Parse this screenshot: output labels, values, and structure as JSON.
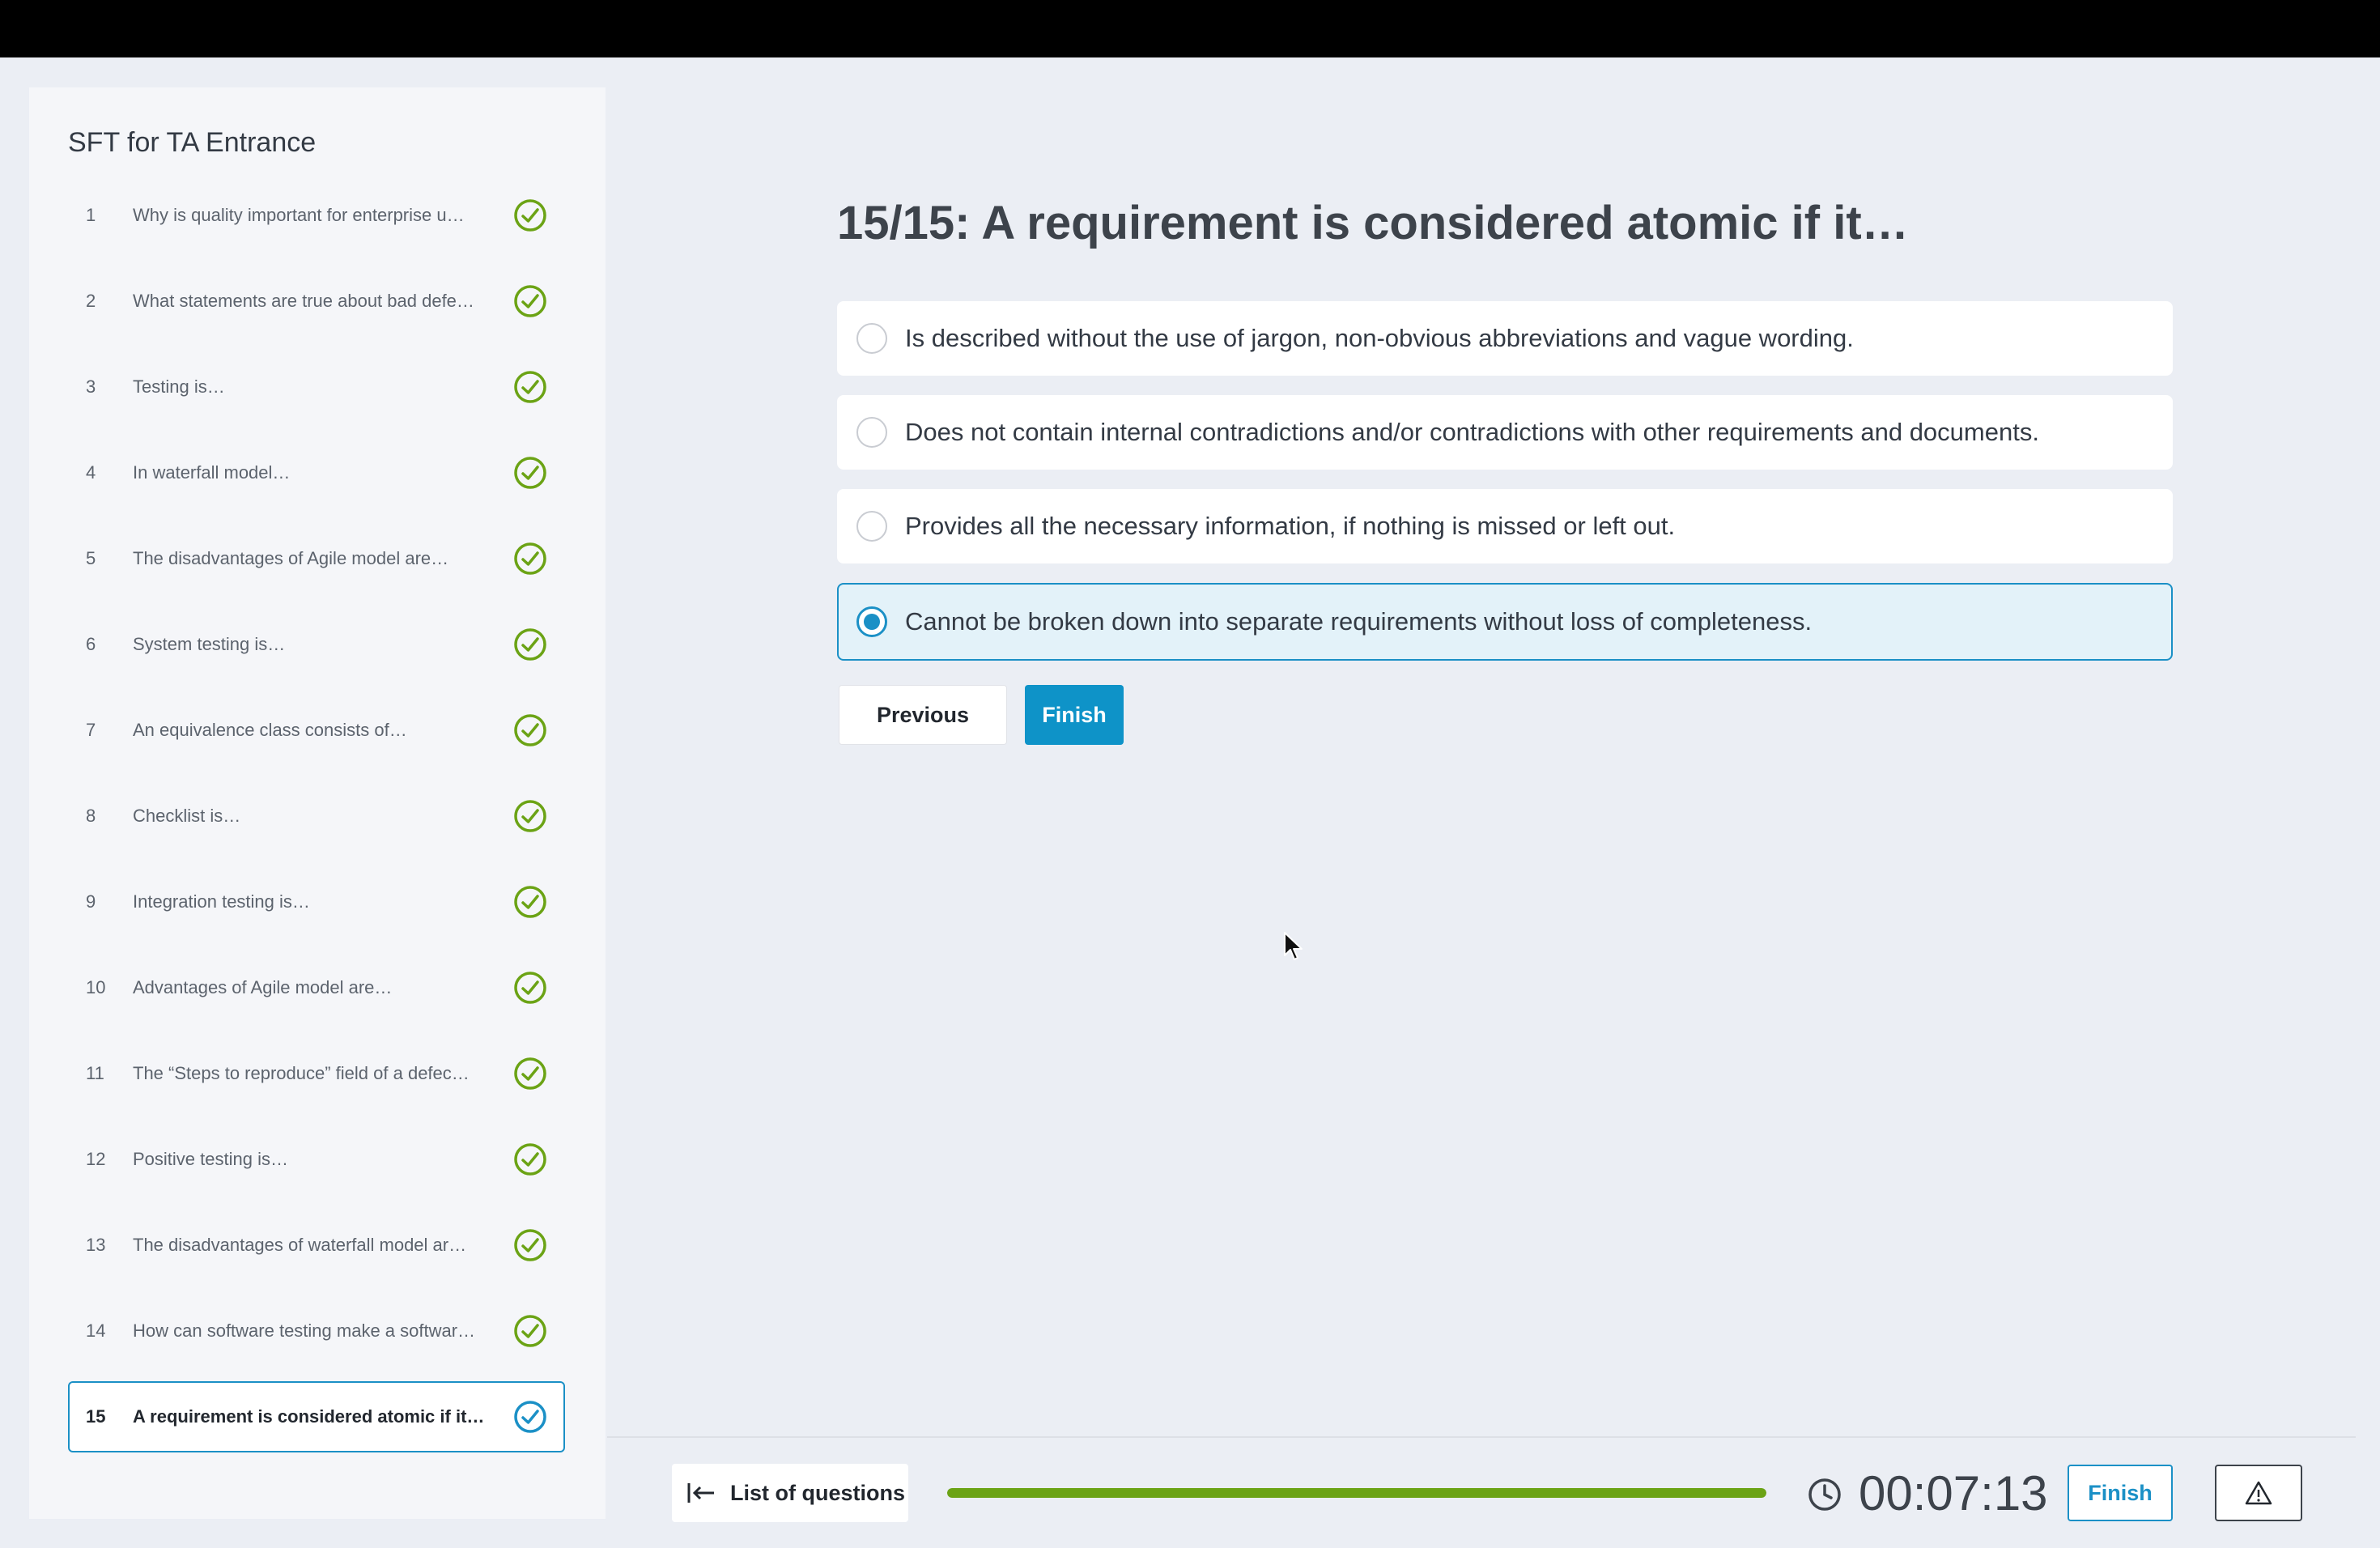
{
  "sidebar": {
    "title": "SFT for TA Entrance",
    "questions": [
      {
        "num": "1",
        "label": "Why is quality important for enterprise u…",
        "status": "answered"
      },
      {
        "num": "2",
        "label": "What statements are true about bad defe…",
        "status": "answered"
      },
      {
        "num": "3",
        "label": "Testing is…",
        "status": "answered"
      },
      {
        "num": "4",
        "label": "In waterfall model…",
        "status": "answered"
      },
      {
        "num": "5",
        "label": "The disadvantages of Agile model are…",
        "status": "answered"
      },
      {
        "num": "6",
        "label": "System testing is…",
        "status": "answered"
      },
      {
        "num": "7",
        "label": "An equivalence class consists of…",
        "status": "answered"
      },
      {
        "num": "8",
        "label": "Checklist is…",
        "status": "answered"
      },
      {
        "num": "9",
        "label": "Integration testing is…",
        "status": "answered"
      },
      {
        "num": "10",
        "label": "Advantages of Agile model are…",
        "status": "answered"
      },
      {
        "num": "11",
        "label": "The “Steps to reproduce” field of a defec…",
        "status": "answered"
      },
      {
        "num": "12",
        "label": "Positive testing is…",
        "status": "answered"
      },
      {
        "num": "13",
        "label": "The disadvantages of waterfall model ar…",
        "status": "answered"
      },
      {
        "num": "14",
        "label": "How can software testing make a softwar…",
        "status": "answered"
      },
      {
        "num": "15",
        "label": "A requirement is considered atomic if it…",
        "status": "answered",
        "active": true
      }
    ]
  },
  "main": {
    "title": "15/15: A requirement is considered atomic if it…",
    "options": [
      {
        "text": "Is described without the use of jargon, non-obvious abbreviations and vague wording.",
        "selected": false
      },
      {
        "text": "Does not contain internal contradictions and/or contradictions with other requirements and documents.",
        "selected": false
      },
      {
        "text": "Provides all the necessary information, if nothing is missed or left out.",
        "selected": false
      },
      {
        "text": "Cannot be broken down into separate requirements without loss of completeness.",
        "selected": true
      }
    ],
    "previous_label": "Previous",
    "finish_label": "Finish"
  },
  "footer": {
    "list_label": "List of questions",
    "progress": 1.0,
    "timer": "00:07:13",
    "finish_label": "Finish"
  },
  "colors": {
    "accent": "#1b90c6",
    "primary_button": "#0e93c8",
    "success": "#6ba315"
  },
  "icons": {
    "answered": "check-circle-icon",
    "list": "arrow-left-bar-icon",
    "timer": "clock-icon",
    "report": "warning-triangle-icon"
  }
}
